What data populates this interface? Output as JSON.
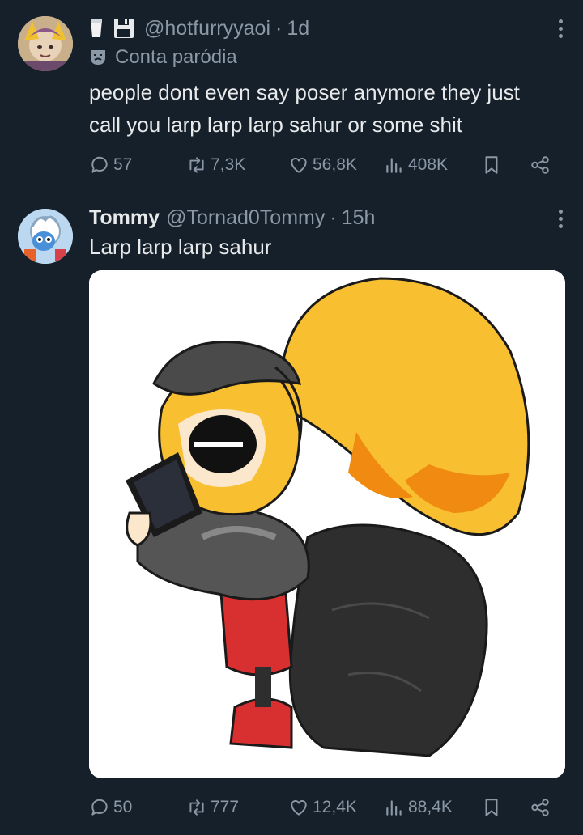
{
  "tweet1": {
    "badges": [
      "milk-glass-icon",
      "floppy-disk-icon"
    ],
    "handle": "@hotfurryyaoi",
    "separator": "·",
    "time": "1d",
    "parody_label": "Conta paródia",
    "text_line1": "people dont even say poser anymore they just",
    "text_line2": "call you larp larp larp sahur or some shit",
    "replies": "57",
    "reposts": "7,3K",
    "likes": "56,8K",
    "views": "408K"
  },
  "tweet2": {
    "name": "Tommy",
    "handle": "@Tornad0Tommy",
    "separator": "·",
    "time": "15h",
    "text": "Larp larp larp sahur",
    "replies": "50",
    "reposts": "777",
    "likes": "12,4K",
    "views": "88,4K"
  },
  "colors": {
    "background": "#15202b",
    "text": "#e7e9ea",
    "muted": "#8b98a5",
    "divider": "#38444d"
  }
}
